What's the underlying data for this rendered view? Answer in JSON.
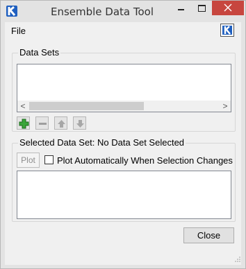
{
  "window": {
    "title": "Ensemble Data Tool",
    "colors": {
      "close_button": "#c7463f",
      "frame": "#e3e3e3",
      "content": "#f0f0f0",
      "accent_logo": "#1f5fbf"
    }
  },
  "menu": {
    "file_label": "File"
  },
  "data_sets": {
    "title": "Data Sets",
    "scroll_left_glyph": "<",
    "scroll_right_glyph": ">",
    "toolbar": {
      "add_icon": "green-plus-icon",
      "remove_icon": "minus-icon",
      "up_icon": "up-arrow-icon",
      "down_icon": "down-arrow-icon"
    }
  },
  "selected": {
    "title": "Selected Data Set: No Data Set Selected",
    "plot_label": "Plot",
    "auto_plot_label": "Plot Automatically When Selection Changes",
    "auto_plot_checked": false
  },
  "footer": {
    "close_label": "Close"
  }
}
